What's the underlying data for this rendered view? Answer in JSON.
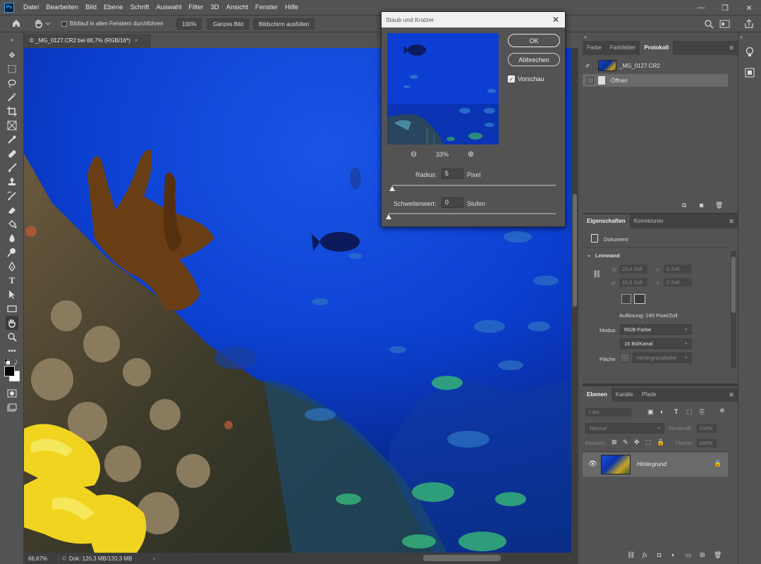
{
  "app": {
    "logo": "Ps",
    "menu": [
      "Datei",
      "Bearbeiten",
      "Bild",
      "Ebene",
      "Schrift",
      "Auswahl",
      "Filter",
      "3D",
      "Ansicht",
      "Fenster",
      "Hilfe"
    ],
    "window_controls": [
      "—",
      "❐",
      "✕"
    ]
  },
  "options_bar": {
    "scroll_all_label": "Bildlauf in allen Fenstern durchführen",
    "zoom_100": "100%",
    "fit_screen": "Ganzes Bild",
    "fill_screen": "Bildschirm ausfüllen"
  },
  "document": {
    "tab_title": "© _MG_0127.CR2 bei 66,7% (RGB/16*)",
    "tab_close": "×",
    "zoom_status": "66,67%",
    "doc_status": "Dok: 120,3 MB/120,3 MB",
    "status_arrow": "›"
  },
  "dialog": {
    "title": "Staub und Kratzer",
    "close": "✕",
    "ok": "OK",
    "cancel": "Abbrechen",
    "preview_label": "Vorschau",
    "preview_checked": true,
    "zoom": "33%",
    "zoom_out_icon": "⊖",
    "zoom_in_icon": "⊕",
    "radius_label": "Radius:",
    "radius_value": "5",
    "radius_unit": "Pixel",
    "threshold_label": "Schwellenwert:",
    "threshold_value": "0",
    "threshold_unit": "Stufen",
    "radius_slider_fraction": 0.0,
    "threshold_slider_fraction": 0.0
  },
  "history_panel": {
    "tabs": [
      "Farbe",
      "Farbfelder",
      "Protokoll"
    ],
    "active_tab": "Protokoll",
    "snapshot_name": "_MG_0127.CR2",
    "steps": [
      "Öffnen"
    ]
  },
  "properties_panel": {
    "tabs": [
      "Eigenschaften",
      "Korrekturen"
    ],
    "active_tab": "Eigenschaften",
    "doc_label": "Dokument",
    "section": "Leinwand",
    "w_label": "W",
    "w_value": "23,4 Zoll",
    "h_label": "H",
    "h_value": "15,6 Zoll",
    "x_label": "X",
    "x_value": "0 Zoll",
    "y_label": "Y",
    "y_value": "0 Zoll",
    "resolution": "Auflösung: 240 Pixel/Zoll",
    "mode_label": "Modus",
    "mode_value": "RGB-Farbe",
    "depth_value": "16 Bit/Kanal",
    "fill_label": "Fläche",
    "fill_value": "Hintergrundfarbe"
  },
  "layers_panel": {
    "tabs": [
      "Ebenen",
      "Kanäle",
      "Pfade"
    ],
    "active_tab": "Ebenen",
    "filter_placeholder": "Art",
    "blend_mode": "Normal",
    "opacity_label": "Deckkraft:",
    "opacity_value": "100%",
    "lock_label": "Fixieren:",
    "fill_label": "Fläche:",
    "fill_value": "100%",
    "layers": [
      {
        "name": "Hintergrund",
        "visible": true,
        "locked": true
      }
    ]
  },
  "colors": {
    "foreground": "#000000",
    "background": "#ffffff",
    "ui_bg": "#535353"
  }
}
